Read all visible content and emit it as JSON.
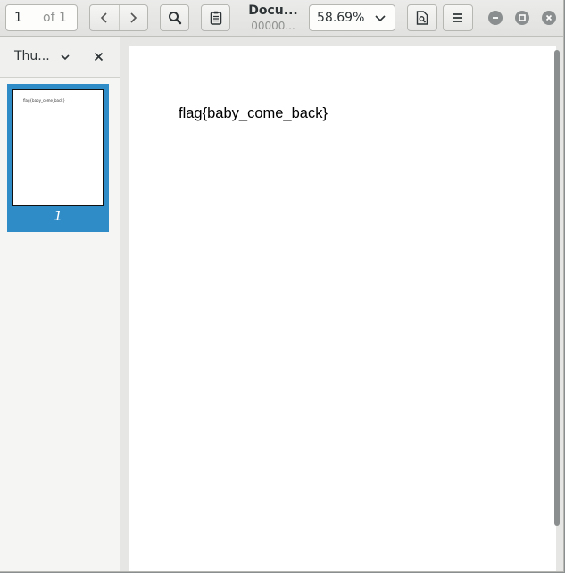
{
  "toolbar": {
    "page_number": "1",
    "page_total": "of 1",
    "doc_title": "Docu...",
    "doc_subtitle": "00000...",
    "zoom": "58.69%"
  },
  "sidebar": {
    "mode_label": "Thu...",
    "thumbnails": [
      {
        "page_label": "1",
        "preview_text": "flag{baby_come_back}"
      }
    ]
  },
  "document": {
    "text": "flag{baby_come_back}"
  },
  "icons": {
    "prev": "chevron-left-icon",
    "next": "chevron-right-icon",
    "search": "search-icon",
    "annotate": "clipboard-icon",
    "send": "document-send-icon",
    "menu": "hamburger-menu-icon",
    "minimize": "minimize-icon",
    "maximize": "maximize-icon",
    "close": "close-icon"
  }
}
